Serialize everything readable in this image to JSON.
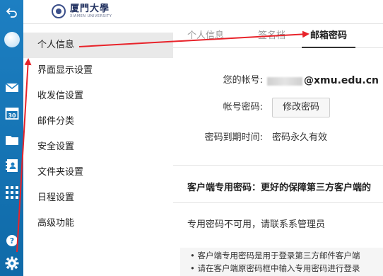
{
  "header": {
    "logo_cn": "厦門大學",
    "logo_en": "XIAMEN UNIVERSITY"
  },
  "rail": {
    "icons": [
      "back-icon",
      "avatar-icon",
      "mail-icon",
      "calendar-icon",
      "folder-icon",
      "contacts-icon",
      "apps-icon",
      "help-icon",
      "settings-icon"
    ]
  },
  "sidebar": {
    "items": [
      {
        "label": "个人信息",
        "active": true
      },
      {
        "label": "界面显示设置"
      },
      {
        "label": "收发信设置"
      },
      {
        "label": "邮件分类"
      },
      {
        "label": "安全设置"
      },
      {
        "label": "文件夹设置"
      },
      {
        "label": "日程设置"
      },
      {
        "label": "高级功能"
      }
    ]
  },
  "tabs": [
    {
      "label": "个人信息"
    },
    {
      "label": "签名档"
    },
    {
      "label": "邮箱密码",
      "active": true
    }
  ],
  "account": {
    "label": "您的帐号:",
    "domain": "@xmu.edu.cn"
  },
  "password": {
    "label": "帐号密码:",
    "button": "修改密码"
  },
  "expiry": {
    "label": "密码到期时间:",
    "value": "密码永久有效"
  },
  "client_password": {
    "title": "客户端专用密码：更好的保障第三方客户端的",
    "status": "专用密码不可用，请联系系管理员",
    "notes": [
      "• 客户端专用密码是用于登录第三方邮件客户端",
      "• 请在客户端原密码框中输入专用密码进行登录"
    ]
  },
  "colors": {
    "rail": "#1d7fc2",
    "annotation_arrow": "#e8232a"
  }
}
